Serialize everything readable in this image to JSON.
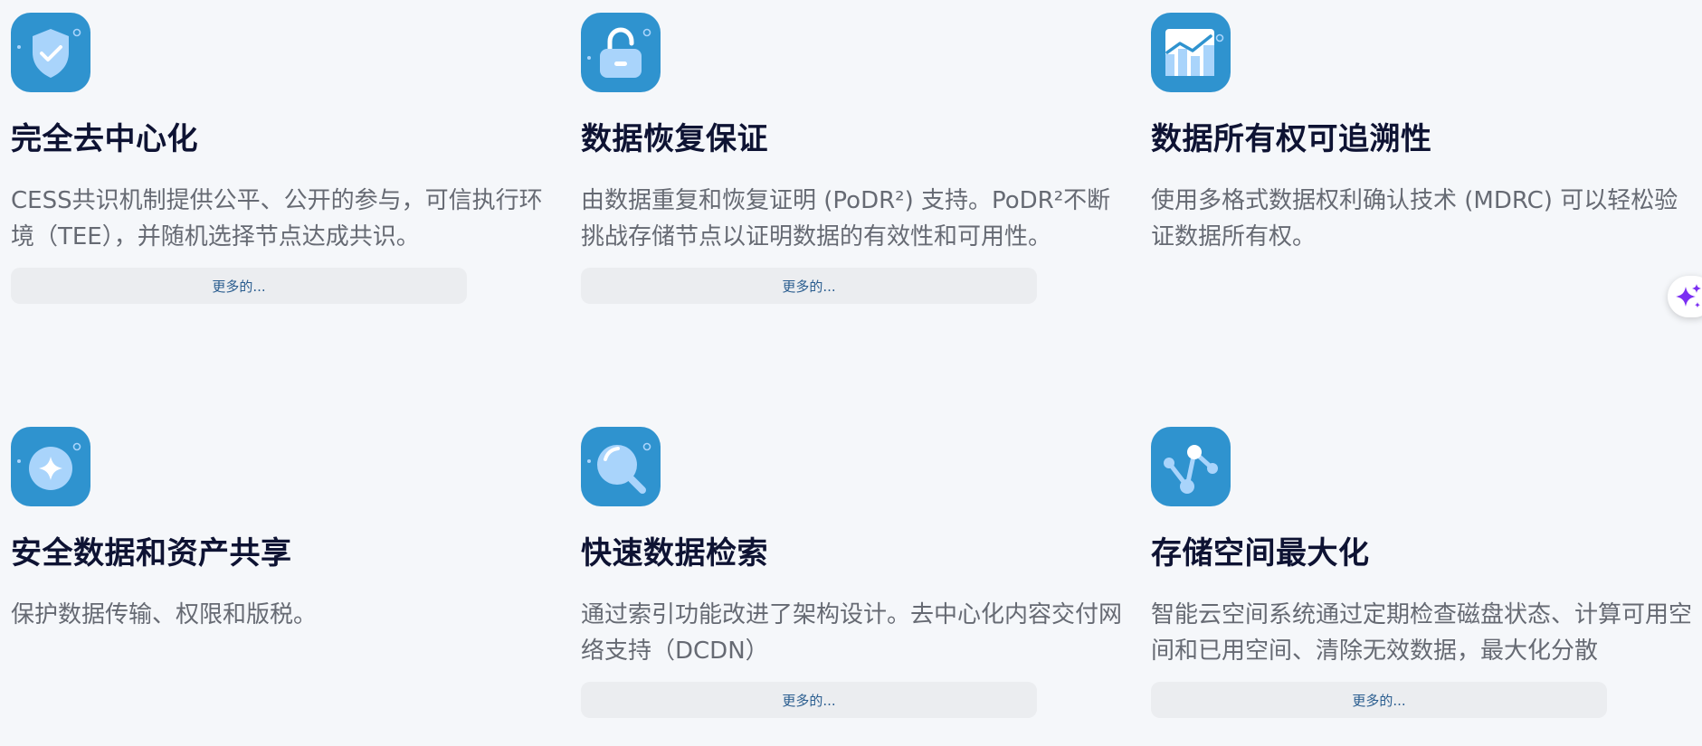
{
  "cards": [
    {
      "icon": "shield-check-icon",
      "title": "完全去中心化",
      "description": "CESS共识机制提供公平、公开的参与，可信执行环境（TEE），并随机选择节点达成共识。",
      "button_label": "更多的..."
    },
    {
      "icon": "unlock-icon",
      "title": "数据恢复保证",
      "description": "由数据重复和恢复证明 (PoDR²) 支持。PoDR²不断挑战存储节点以证明数据的有效性和可用性。",
      "button_label": "更多的..."
    },
    {
      "icon": "chart-growth-icon",
      "title": "数据所有权可追溯性",
      "description": "使用多格式数据权利确认技术 (MDRC) 可以轻松验证数据所有权。"
    },
    {
      "icon": "sparkle-circle-icon",
      "title": "安全数据和资产共享",
      "description": "保护数据传输、权限和版税。"
    },
    {
      "icon": "magnifier-icon",
      "title": "快速数据检索",
      "description": "通过索引功能改进了架构设计。去中心化内容交付网络支持（DCDN）",
      "button_label": "更多的..."
    },
    {
      "icon": "network-nodes-icon",
      "title": "存储空间最大化",
      "description": "智能云空间系统通过定期检查磁盘状态、计算可用空间和已用空间、清除无效数据，最大化分散",
      "button_label": "更多的..."
    }
  ],
  "floating_assistant": {
    "icon": "ai-sparkle-icon"
  },
  "colors": {
    "background": "#f5f7fa",
    "icon_bg": "#2f93cf",
    "icon_fg": "#a9d4fb",
    "title": "#0e1333",
    "description": "#666a73",
    "button_bg": "#ebedf0",
    "button_text": "#2a5d8f",
    "assistant_accent": "#7b2ff2"
  }
}
